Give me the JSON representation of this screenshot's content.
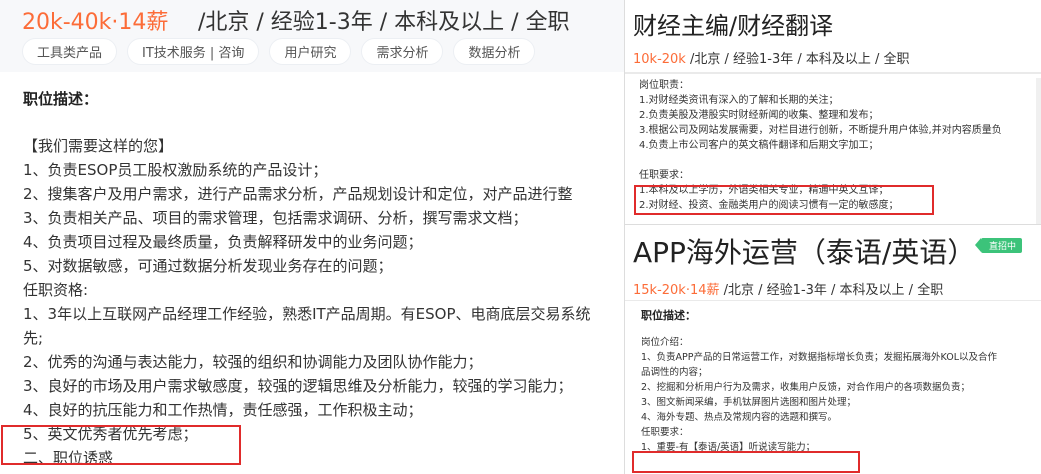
{
  "left_job": {
    "salary": "20k-40k·14薪",
    "meta": " /北京 / 经验1-3年 / 本科及以上 / 全职",
    "tags": [
      "工具类产品",
      "IT技术服务 | 咨询",
      "用户研究",
      "需求分析",
      "数据分析"
    ],
    "desc_title": "职位描述：",
    "lines": [
      "【我们需要这样的您】",
      "1、负责ESOP员工股权激励系统的产品设计；",
      "2、搜集客户及用户需求，进行产品需求分析，产品规划设计和定位，对产品进行整",
      "3、负责相关产品、项目的需求管理，包括需求调研、分析，撰写需求文档；",
      "4、负责项目过程及最终质量，负责解释研发中的业务问题；",
      "5、对数据敏感，可通过数据分析发现业务存在的问题；",
      "任职资格:",
      "1、3年以上互联网产品经理工作经验，熟悉IT产品周期。有ESOP、电商底层交易系统",
      "先;",
      "2、优秀的沟通与表达能力，较强的组织和协调能力及团队协作能力；",
      "3、良好的市场及用户需求敏感度，较强的逻辑思维及分析能力，较强的学习能力；",
      "4、良好的抗压能力和工作热情，责任感强，工作积极主动；",
      "5、英文优秀者优先考虑；",
      "二、职位诱惑"
    ]
  },
  "right_top_job": {
    "title": "财经主编/财经翻译",
    "salary": "10k-20k",
    "meta": " /北京 / 经验1-3年 / 本科及以上 / 全职",
    "lines": [
      "岗位职责：",
      "1.对财经类资讯有深入的了解和长期的关注；",
      "2.负责美股及港股实时财经新闻的收集、整理和发布；",
      "3.根据公司及网站发展需要，对栏目进行创新，不断提升用户体验,并对内容质量负",
      "4.负责上市公司客户的英文稿件翻译和后期文字加工；",
      "",
      "任职要求：",
      "1.本科及以上学历，外语类相关专业，精通中英文互译；",
      "2.对财经、投资、金融类用户的阅读习惯有一定的敏感度；"
    ]
  },
  "right_bottom_job": {
    "title": "APP海外运营（泰语/英语）",
    "live_badge": "直招中",
    "salary": "15k-20k·14薪",
    "meta": " /北京 / 经验1-3年 / 本科及以上 / 全职",
    "desc_title": "职位描述：",
    "lines": [
      "岗位介绍：",
      "1、负责APP产品的日常运营工作，对数据指标增长负责；发掘拓展海外KOL以及合作",
      "品调性的内容；",
      "2、挖掘和分析用户行为及需求，收集用户反馈，对合作用户的各项数据负责；",
      "3、图文新闻采编，手机钛屏图片选图和图片处理；",
      "4、海外专题、热点及常规内容的选题和撰写。",
      "任职要求：",
      "1、重要-有【泰语/英语】听说读写能力；"
    ]
  },
  "colors": {
    "salary": "#fc6c38",
    "highlight_box": "#e02b2b",
    "live_badge": "#3cc37a"
  }
}
